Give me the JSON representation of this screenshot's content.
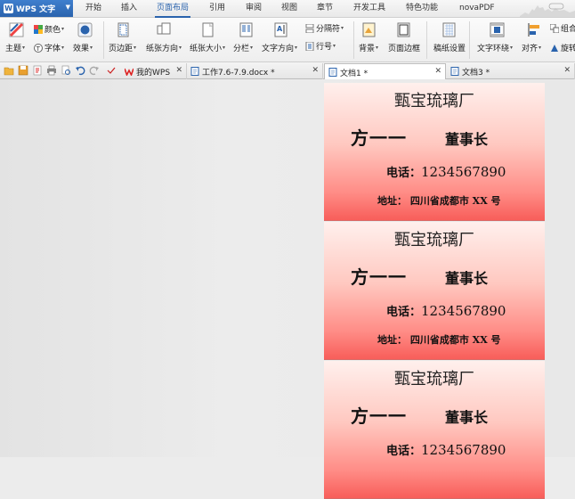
{
  "app": {
    "name": "WPS 文字"
  },
  "menu": {
    "tabs": [
      "开始",
      "插入",
      "页面布局",
      "引用",
      "审阅",
      "视图",
      "章节",
      "开发工具",
      "特色功能",
      "novaPDF"
    ],
    "active": "页面布局"
  },
  "ribbon": {
    "theme": "主题",
    "color": "颜色",
    "font": "字体",
    "effect": "效果",
    "margins": "页边距",
    "orientation": "纸张方向",
    "size": "纸张大小",
    "columns": "分栏",
    "text_direction": "文字方向",
    "breaks": "分隔符",
    "line_numbers": "行号",
    "background": "背景",
    "page_border": "页面边框",
    "manuscript": "稿纸设置",
    "text_wrap": "文字环绕",
    "align": "对齐",
    "group": "组合",
    "rotate": "旋转"
  },
  "doc_tabs": [
    {
      "label": "我的WPS"
    },
    {
      "label": "工作7.6-7.9.docx *"
    },
    {
      "label": "文档1 *"
    },
    {
      "label": "文档3 *"
    }
  ],
  "cards": [
    {
      "company": "甄宝琉璃厂",
      "name": "方一一",
      "title": "董事长",
      "phone_label": "电话：",
      "phone": "1234567890",
      "address": "地址：  四川省成都市 XX 号"
    },
    {
      "company": "甄宝琉璃厂",
      "name": "方一一",
      "title": "董事长",
      "phone_label": "电话：",
      "phone": "1234567890",
      "address": "地址：  四川省成都市 XX 号"
    },
    {
      "company": "甄宝琉璃厂",
      "name": "方一一",
      "title": "董事长",
      "phone_label": "电话：",
      "phone": "1234567890",
      "address": ""
    }
  ],
  "colors": {
    "accent": "#2a63ad",
    "card_top": "#fff0ed",
    "card_bottom": "#f85e5a"
  }
}
